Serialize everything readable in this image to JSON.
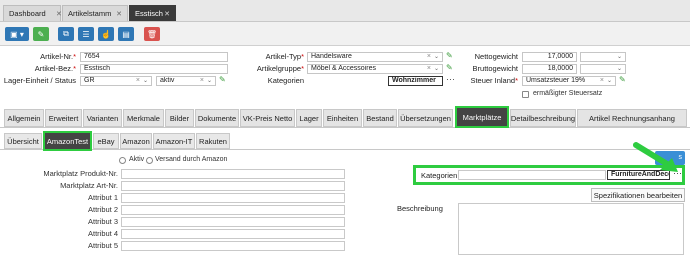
{
  "tabs": [
    {
      "label": "Dashboard"
    },
    {
      "label": "Artikelstamm"
    },
    {
      "label": "Esstisch"
    }
  ],
  "toolbar": {
    "buttons": [
      {
        "icon": "save-icon"
      },
      {
        "icon": "edit-icon"
      },
      {
        "icon": "copy-icon"
      },
      {
        "icon": "list-icon"
      },
      {
        "icon": "hand-icon"
      },
      {
        "icon": "document-icon"
      },
      {
        "icon": "trash-icon"
      }
    ]
  },
  "form": {
    "artnr_label": "Artikel-Nr.",
    "artnr_value": "7654",
    "artbez_label": "Artikel-Bez.",
    "artbez_value": "Esstisch",
    "lager_label": "Lager-Einheit / Status",
    "lager_value": "GR",
    "status_value": "aktiv",
    "typ_label": "Artikel-Typ",
    "typ_value": "Handelsware",
    "gruppe_label": "Artikelgruppe",
    "gruppe_value": "Möbel & Accessoires",
    "kat_label": "Kategorien",
    "kat_value": "Wohnzimmer",
    "netto_label": "Nettogewicht",
    "netto_value": "17,0000",
    "brutto_label": "Bruttogewicht",
    "brutto_value": "18,0000",
    "steuer_label": "Steuer Inland",
    "steuer_value": "Umsatzsteuer 19%",
    "ermaessigt_label": "ermäßigter Steuersatz",
    "required_mark": "*",
    "ellipsis": "⋯",
    "clear": "×",
    "arrow": "⌄",
    "pen": "✎"
  },
  "main_tabs": [
    "Allgemein",
    "Erweitert",
    "Varianten",
    "Merkmale",
    "Bilder",
    "Dokumente",
    "VK-Preis Netto",
    "Lager",
    "Einheiten",
    "Bestand",
    "Übersetzungen",
    "Marktplätze",
    "Detailbeschreibung",
    "Artikel Rechnungsanhang"
  ],
  "sub_tabs": [
    "Übersicht",
    "AmazonTest",
    "eBay",
    "Amazon",
    "Amazon-IT",
    "Rakuten"
  ],
  "marketplace": {
    "aktiv_label": "Aktiv",
    "versand_label": "Versand durch Amazon",
    "fields": [
      "Marktplatz Produkt-Nr.",
      "Marktplatz Art-Nr.",
      "Attribut 1",
      "Attribut 2",
      "Attribut 3",
      "Attribut 4",
      "Attribut 5"
    ],
    "kategorien_label": "Kategorien",
    "kategorien_value": "FurnitureAndDecor",
    "spez_button": "Spezifikationen bearbeiten",
    "beschreibung_label": "Beschreibung"
  },
  "colors": {
    "accent": "#2ecc40",
    "primary": "#2f77b5",
    "dark_tab": "#3a3a3a"
  }
}
